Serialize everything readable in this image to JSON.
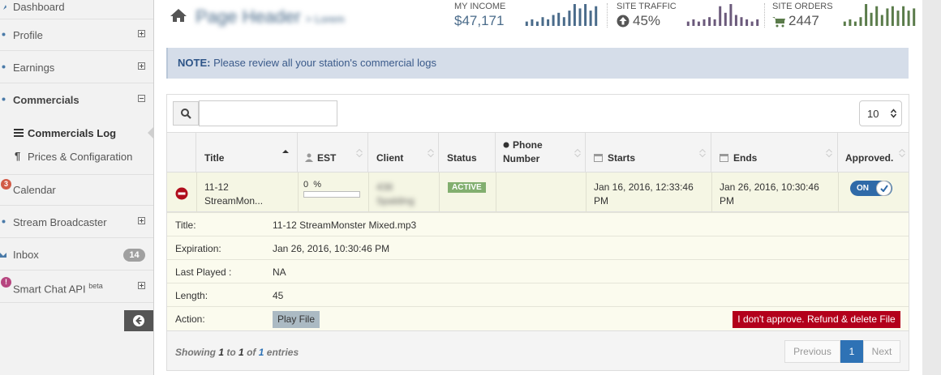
{
  "sidebar": {
    "items": [
      {
        "label": "Dashboard"
      },
      {
        "label": "Profile"
      },
      {
        "label": "Earnings"
      },
      {
        "label": "Commercials"
      },
      {
        "label": "Calendar",
        "badge": "3"
      },
      {
        "label": "Stream Broadcaster"
      },
      {
        "label": "Inbox",
        "count": "14"
      },
      {
        "label": "Smart Chat API",
        "sup": "beta",
        "badge": "!"
      }
    ],
    "subitems": [
      {
        "label": "Commercials Log"
      },
      {
        "label": "Prices & Configaration"
      }
    ]
  },
  "header": {
    "title": "Page Header",
    "subtitle": "> Lorem",
    "stats": [
      {
        "label": "MY INCOME",
        "value": "$47,171",
        "color": "#4a6b8a",
        "bars": [
          2,
          3,
          2,
          4,
          3,
          5,
          6,
          4,
          7,
          10,
          8,
          10,
          7,
          9
        ]
      },
      {
        "label": "SITE TRAFFIC",
        "value": "45%",
        "color": "#6b5a7b",
        "bars": [
          2,
          3,
          2,
          3,
          4,
          3,
          9,
          6,
          10,
          5,
          4,
          3,
          2,
          3
        ]
      },
      {
        "label": "SITE ORDERS",
        "value": "2447",
        "color": "#5a7b4a",
        "bars": [
          2,
          3,
          2,
          4,
          10,
          6,
          9,
          5,
          8,
          9,
          7,
          9,
          7,
          8
        ]
      }
    ]
  },
  "note": {
    "bold": "NOTE:",
    "text": "Please review all your station's commercial logs"
  },
  "table": {
    "search_placeholder": "",
    "page_size": "10",
    "headers": {
      "title": "Title",
      "est": "EST",
      "client": "Client",
      "status": "Status",
      "phone1": "Phone",
      "phone2": "Number",
      "starts": "Starts",
      "ends": "Ends",
      "approved": "Approved."
    },
    "row": {
      "title1": "11-12",
      "title2": "StreamMon...",
      "est_value": "0",
      "est_unit": "%",
      "est_progress": 0,
      "client1": "438",
      "client2": "Spalding",
      "status": "ACTIVE",
      "starts1": "Jan 16, 2016, 12:33:46",
      "starts2": "PM",
      "ends1": "Jan 26, 2016, 10:30:46",
      "ends2": "PM",
      "toggle": "ON"
    },
    "details": [
      {
        "key": "Title:",
        "value": "11-12 StreamMonster Mixed.mp3"
      },
      {
        "key": "Expiration:",
        "value": "Jan 26, 2016, 10:30:46 PM"
      },
      {
        "key": "Last Played :",
        "value": "NA"
      },
      {
        "key": "Length:",
        "value": "45"
      },
      {
        "key": "Action:",
        "value": ""
      }
    ],
    "play_button": "Play File",
    "refund_button": "I don't approve. Refund & delete File",
    "footer": {
      "showing": "Showing",
      "from": "1",
      "to_word": "to",
      "to": "1",
      "of_word": "of",
      "total": "1",
      "entries": "entries"
    },
    "pagination": {
      "previous": "Previous",
      "page": "1",
      "next": "Next"
    }
  },
  "colors": {
    "status_active": "#82af6f",
    "toggle_on": "#2f6aa8",
    "refund": "#b3001b",
    "pager_active": "#2e72b5"
  }
}
